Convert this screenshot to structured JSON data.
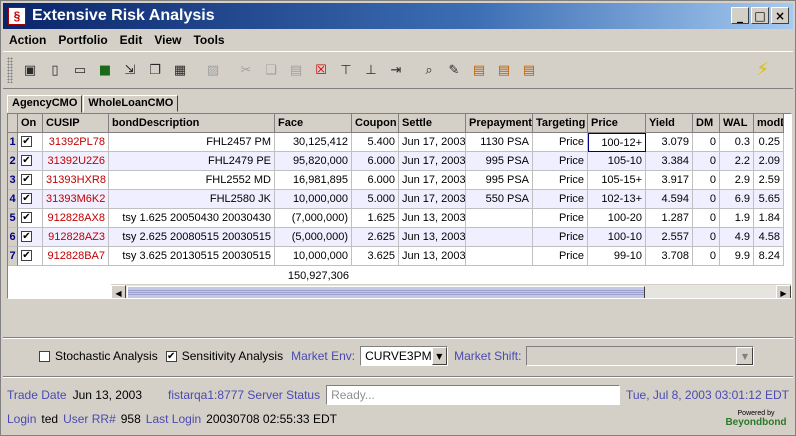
{
  "window": {
    "title": "Extensive Risk Analysis",
    "controls": [
      "_",
      "□",
      "×"
    ]
  },
  "menu": [
    "Action",
    "Portfolio",
    "Edit",
    "View",
    "Tools"
  ],
  "toolbar": {
    "icons": [
      "new-icon",
      "document-icon",
      "remove-icon",
      "save-icon",
      "import-icon",
      "copy-portfolio-icon",
      "calculator-icon",
      "disabled-icon",
      "cut-icon",
      "copy-icon",
      "paste-icon",
      "delete-icon",
      "insert-row-above-icon",
      "insert-row-below-icon",
      "export-icon",
      "zoom-icon",
      "edit-icon",
      "chart-icon",
      "chart2-icon",
      "chart3-icon"
    ],
    "lightning_icon": "lightning-icon"
  },
  "tabs": [
    "AgencyCMO",
    "WholeLoanCMO"
  ],
  "table": {
    "headers": [
      "On",
      "CUSIP",
      "bondDescription",
      "Face",
      "Coupon",
      "Settle",
      "Prepayment",
      "Targeting",
      "Price",
      "Yield",
      "DM",
      "WAL",
      "modDu"
    ],
    "rows": [
      {
        "num": "1",
        "on": "✔",
        "cusip": "31392PL78",
        "desc": "FHL2457 PM",
        "face": "30,125,412",
        "coupon": "5.400",
        "settle": "Jun 17, 2003",
        "prepay": "1130 PSA",
        "targeting": "Price",
        "price": "100-12+",
        "yield": "3.079",
        "dm": "0",
        "wal": "0.3",
        "moddu": "0.25"
      },
      {
        "num": "2",
        "on": "✔",
        "cusip": "31392U2Z6",
        "desc": "FHL2479 PE",
        "face": "95,820,000",
        "coupon": "6.000",
        "settle": "Jun 17, 2003",
        "prepay": "995 PSA",
        "targeting": "Price",
        "price": "105-10",
        "yield": "3.384",
        "dm": "0",
        "wal": "2.2",
        "moddu": "2.09"
      },
      {
        "num": "3",
        "on": "✔",
        "cusip": "31393HXR8",
        "desc": "FHL2552 MD",
        "face": "16,981,895",
        "coupon": "6.000",
        "settle": "Jun 17, 2003",
        "prepay": "995 PSA",
        "targeting": "Price",
        "price": "105-15+",
        "yield": "3.917",
        "dm": "0",
        "wal": "2.9",
        "moddu": "2.59"
      },
      {
        "num": "4",
        "on": "✔",
        "cusip": "31393M6K2",
        "desc": "FHL2580 JK",
        "face": "10,000,000",
        "coupon": "5.000",
        "settle": "Jun 17, 2003",
        "prepay": "550 PSA",
        "targeting": "Price",
        "price": "102-13+",
        "yield": "4.594",
        "dm": "0",
        "wal": "6.9",
        "moddu": "5.65"
      },
      {
        "num": "5",
        "on": "✔",
        "cusip": "912828AX8",
        "desc": "tsy 1.625 20050430 20030430",
        "face": "(7,000,000)",
        "coupon": "1.625",
        "settle": "Jun 13, 2003",
        "prepay": "",
        "targeting": "Price",
        "price": "100-20",
        "yield": "1.287",
        "dm": "0",
        "wal": "1.9",
        "moddu": "1.84"
      },
      {
        "num": "6",
        "on": "✔",
        "cusip": "912828AZ3",
        "desc": "tsy 2.625 20080515 20030515",
        "face": "(5,000,000)",
        "coupon": "2.625",
        "settle": "Jun 13, 2003",
        "prepay": "",
        "targeting": "Price",
        "price": "100-10",
        "yield": "2.557",
        "dm": "0",
        "wal": "4.9",
        "moddu": "4.58"
      },
      {
        "num": "7",
        "on": "✔",
        "cusip": "912828BA7",
        "desc": "tsy 3.625 20130515 20030515",
        "face": "10,000,000",
        "coupon": "3.625",
        "settle": "Jun 13, 2003",
        "prepay": "",
        "targeting": "Price",
        "price": "99-10",
        "yield": "3.708",
        "dm": "0",
        "wal": "9.9",
        "moddu": "8.24"
      }
    ],
    "face_total": "150,927,306"
  },
  "options": {
    "stochastic_label": "Stochastic Analysis",
    "stochastic_checked": "",
    "sensitivity_label": "Sensitivity Analysis",
    "sensitivity_checked": "✔",
    "market_env_label": "Market Env:",
    "market_env_value": "CURVE3PM",
    "market_shift_label": "Market Shift:",
    "market_shift_value": ""
  },
  "status": {
    "trade_date_label": "Trade Date",
    "trade_date": "Jun 13, 2003",
    "server_label": "fistarqa1:8777 Server Status",
    "server_status": "Ready...",
    "datetime": "Tue, Jul 8, 2003 03:01:12 EDT"
  },
  "login": {
    "login_label": "Login",
    "user": "ted",
    "rr_label": "User RR#",
    "rr": "958",
    "last_login_label": "Last Login",
    "last_login": "20030708 02:55:33 EDT"
  },
  "logo": {
    "powered_by": "Powered by",
    "brand": "Beyondbond"
  }
}
